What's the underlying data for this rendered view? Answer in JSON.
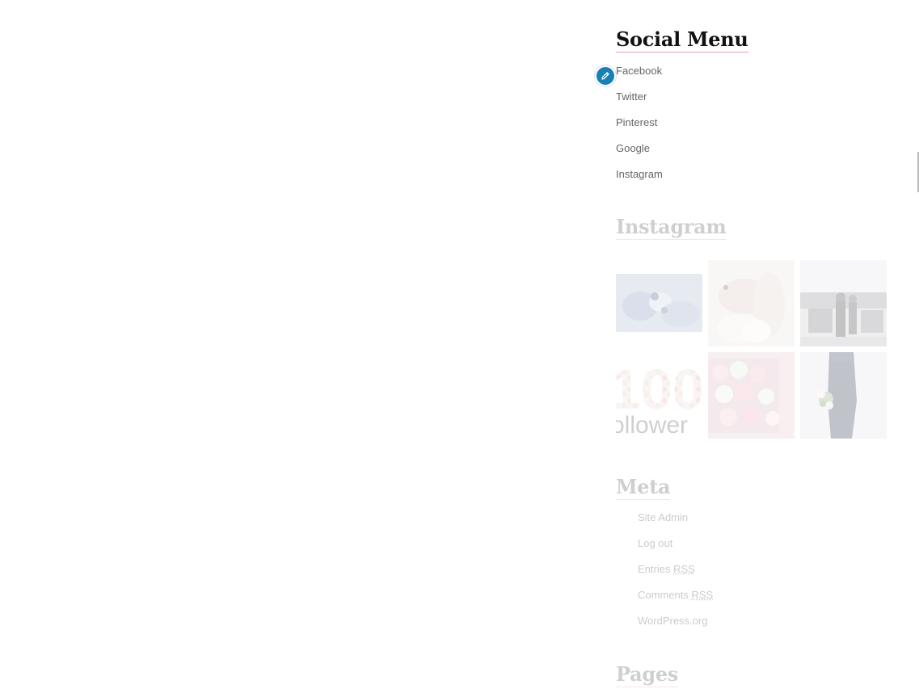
{
  "social_menu": {
    "title": "Social Menu",
    "items": [
      {
        "label": "Facebook"
      },
      {
        "label": "Twitter"
      },
      {
        "label": "Pinterest"
      },
      {
        "label": "Google"
      },
      {
        "label": "Instagram"
      }
    ]
  },
  "edit_shortcut": {
    "icon": "pencil-icon",
    "color": "#1a7fb5"
  },
  "instagram": {
    "title": "Instagram",
    "tiles": [
      {
        "name": "blue-flowers-photo"
      },
      {
        "name": "hands-with-ring-photo"
      },
      {
        "name": "crowd-event-photo"
      },
      {
        "name": "100-followers-photo",
        "text_top": "100",
        "text_bottom": "ollower"
      },
      {
        "name": "pink-roses-box-photo"
      },
      {
        "name": "woman-with-bouquet-photo"
      }
    ]
  },
  "meta": {
    "title": "Meta",
    "items": [
      {
        "label": "Site Admin"
      },
      {
        "label": "Log out"
      },
      {
        "label": "Entries ",
        "abbr": "RSS"
      },
      {
        "label": "Comments ",
        "abbr": "RSS"
      },
      {
        "label": "WordPress.org"
      }
    ]
  },
  "pages": {
    "title": "Pages"
  },
  "colors": {
    "title_underline": "#e8a0b8",
    "edit_button": "#1a7fb5",
    "link_text": "#666666"
  }
}
